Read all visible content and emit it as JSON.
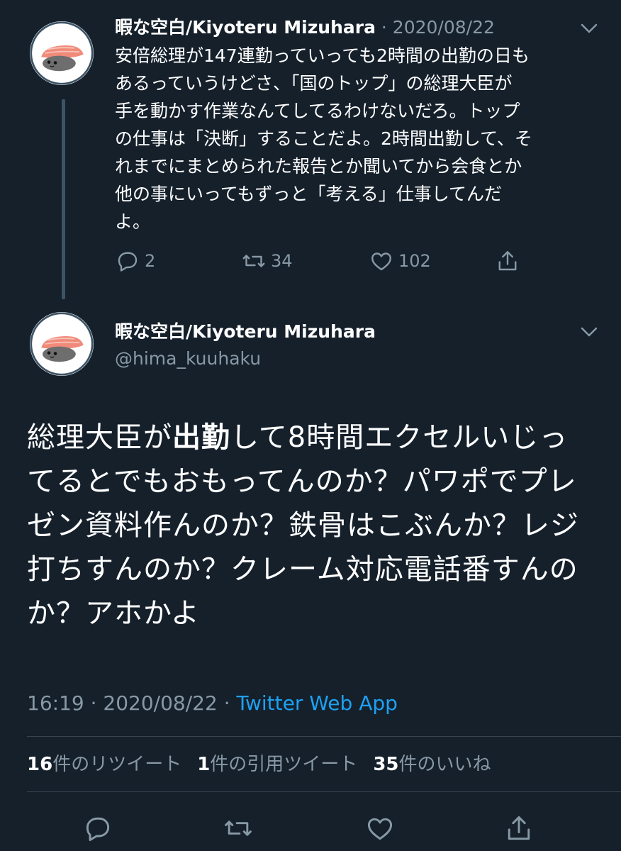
{
  "colors": {
    "background": "#15202b",
    "muted": "#8899a6",
    "link": "#1da1f2",
    "divider": "#38444d"
  },
  "parent_tweet": {
    "author_name": "暇な空白/Kiyoteru Mizuhara",
    "separator": " · ",
    "date": "2020/08/22",
    "text": "安倍総理が147連勤っていっても2時間の出勤の日も\nあるっていうけどさ、「国のトップ」の総理大臣が\n手を動かす作業なんてしてるわけないだろ。トップ\nの仕事は「決断」することだよ。2時間出勤して、そ\nれまでにまとめられた報告とか聞いてから会食とか\n他の事にいってもずっと「考える」仕事してんだ\nよ。",
    "replies": "2",
    "retweets": "34",
    "likes": "102",
    "icons": [
      "reply-icon",
      "retweet-icon",
      "like-icon",
      "share-icon",
      "caret-down-icon"
    ]
  },
  "main_tweet": {
    "author_name": "暇な空白/Kiyoteru Mizuhara",
    "handle": "@hima_kuuhaku",
    "text_before": "総理大臣が",
    "text_bold": "出勤",
    "text_after": "して8時間エクセルいじってるとでもおもってんのか？パワポでプレゼン資料作んのか？鉄骨はこぶんか？レジ打ちすんのか？クレーム対応電話番すんのか？アホかよ",
    "time": "16:19",
    "separator": " · ",
    "date": "2020/08/22",
    "separator2": " · ",
    "source": "Twitter Web App",
    "stats": {
      "retweets_count": "16",
      "retweets_label": "件のリツイート",
      "quotes_count": "1",
      "quotes_label": "件の引用ツイート",
      "likes_count": "35",
      "likes_label": "件のいいね"
    },
    "icons": [
      "reply-icon",
      "retweet-icon",
      "like-icon",
      "share-icon",
      "caret-down-icon"
    ]
  }
}
